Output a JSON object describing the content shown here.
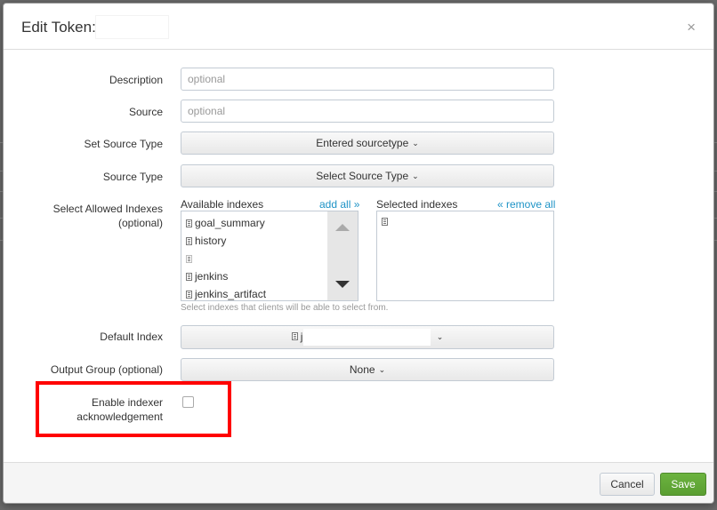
{
  "dialog": {
    "title": "Edit Token:",
    "close_symbol": "×"
  },
  "form": {
    "description": {
      "label": "Description",
      "placeholder": "optional",
      "value": ""
    },
    "source": {
      "label": "Source",
      "placeholder": "optional",
      "value": ""
    },
    "set_source_type": {
      "label": "Set Source Type",
      "value": "Entered sourcetype"
    },
    "source_type": {
      "label": "Source Type",
      "value": "Select Source Type"
    },
    "allowed_indexes": {
      "label_line1": "Select Allowed Indexes",
      "label_line2": "(optional)",
      "available_header": "Available indexes",
      "add_all": "add all »",
      "selected_header": "Selected indexes",
      "remove_all": "« remove all",
      "available_items": [
        "goal_summary",
        "history",
        "",
        "jenkins",
        "jenkins_artifact"
      ],
      "help": "Select indexes that clients will be able to select from."
    },
    "default_index": {
      "label": "Default Index",
      "value": "j"
    },
    "output_group": {
      "label": "Output Group (optional)",
      "value": "None"
    },
    "indexer_ack": {
      "label_line1": "Enable indexer",
      "label_line2": "acknowledgement",
      "checked": false
    }
  },
  "footer": {
    "cancel_label": "Cancel",
    "save_label": "Save"
  },
  "colors": {
    "accent_link": "#1e93c6",
    "save_button": "#5a9e31",
    "highlight_box": "#ff0000"
  }
}
